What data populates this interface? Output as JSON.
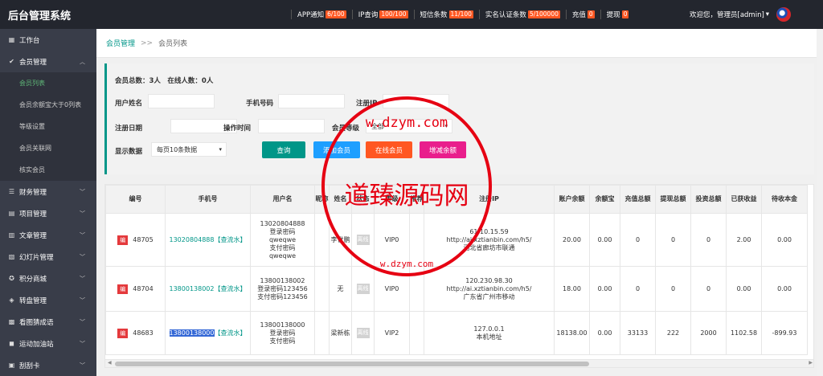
{
  "app": {
    "title": "后台管理系统"
  },
  "topbar": {
    "items": [
      {
        "label": "APP通知",
        "badge": "6/100"
      },
      {
        "label": "IP查询",
        "badge": "100/100"
      },
      {
        "label": "短信条数",
        "badge": "11/100"
      },
      {
        "label": "实名认证条数",
        "badge": "5/100000"
      },
      {
        "label": "充值",
        "badge": "0"
      },
      {
        "label": "提现",
        "badge": "0"
      }
    ],
    "welcome": "欢迎您，管理员[admin]"
  },
  "sidebar": {
    "items": [
      {
        "label": "工作台"
      },
      {
        "label": "会员管理"
      },
      {
        "label": "财务管理"
      },
      {
        "label": "项目管理"
      },
      {
        "label": "文章管理"
      },
      {
        "label": "幻灯片管理"
      },
      {
        "label": "积分商城"
      },
      {
        "label": "转盘管理"
      },
      {
        "label": "看图猜成语"
      },
      {
        "label": "运动加油站"
      },
      {
        "label": "刮刮卡"
      }
    ],
    "subitems": [
      {
        "label": "会员列表"
      },
      {
        "label": "会员余额宝大于0列表"
      },
      {
        "label": "等级设置"
      },
      {
        "label": "会员关联网"
      },
      {
        "label": "核实会员"
      }
    ]
  },
  "breadcrumb": {
    "parent": "会员管理",
    "sep": ">>",
    "current": "会员列表"
  },
  "filter": {
    "stats": "会员总数：3人　在线人数：0人",
    "name_label": "用户姓名",
    "phone_label": "手机号码",
    "ip_label": "注册IP",
    "date_label": "注册日期",
    "optime_label": "操作时间",
    "level_label": "会员等级",
    "level_value": "全部",
    "show_label": "显示数据",
    "show_value": "每页10条数据",
    "btn_search": "查询",
    "btn_add": "添加会员",
    "btn_online": "在线会员",
    "btn_balance": "增减余额"
  },
  "table": {
    "headers": [
      "编号",
      "手机号",
      "用户名",
      "昵称",
      "姓名",
      "状态",
      "等级",
      "推荐",
      "注册IP",
      "账户余额",
      "余额宝",
      "充值总额",
      "提现总额",
      "投资总额",
      "已获收益",
      "待收本金"
    ],
    "tag": "编",
    "offline": "离线",
    "rows": [
      {
        "id": "48705",
        "phone": "13020804888",
        "phone_extra": "【查流水】",
        "user": "13020804888",
        "user_lines": [
          "登录密码",
          "qweqwe",
          "支付密码",
          "qweqwe"
        ],
        "nick": "",
        "name": "李世鹏",
        "level": "VIP0",
        "ip": "61.10.15.59",
        "ip_url": "http://ai.xztianbin.com/h5/",
        "ip_loc": "河北省廊坊市联通",
        "balance": "20.00",
        "yeb": "0.00",
        "recharge": "0",
        "withdraw": "0",
        "invest": "0",
        "earned": "2.00",
        "pending": "0.00"
      },
      {
        "id": "48704",
        "phone": "13800138002",
        "phone_extra": "【查流水】",
        "user": "13800138002",
        "user_lines": [
          "登录密码123456",
          "支付密码123456"
        ],
        "nick": "",
        "name": "无",
        "level": "VIP0",
        "ip": "120.230.98.30",
        "ip_url": "http://ai.xztianbin.com/h5/",
        "ip_loc": "广东省广州市移动",
        "balance": "18.00",
        "yeb": "0.00",
        "recharge": "0",
        "withdraw": "0",
        "invest": "0",
        "earned": "0.00",
        "pending": "0.00"
      },
      {
        "id": "48683",
        "phone": "13800138000",
        "phone_extra": "【查流水】",
        "user": "13800138000",
        "user_lines": [
          "登录密码",
          "支付密码"
        ],
        "nick": "",
        "name": "梁新栋",
        "level": "VIP2",
        "ip": "127.0.0.1",
        "ip_url": "",
        "ip_loc": "本机地址",
        "balance": "18138.00",
        "yeb": "0.00",
        "recharge": "33133",
        "withdraw": "222",
        "invest": "2000",
        "earned": "1102.58",
        "pending": "-899.93"
      }
    ]
  },
  "watermark": {
    "text": "道臻源码网",
    "url_top": "w.dzym.com",
    "url_bottom": "w.dzym.com"
  }
}
